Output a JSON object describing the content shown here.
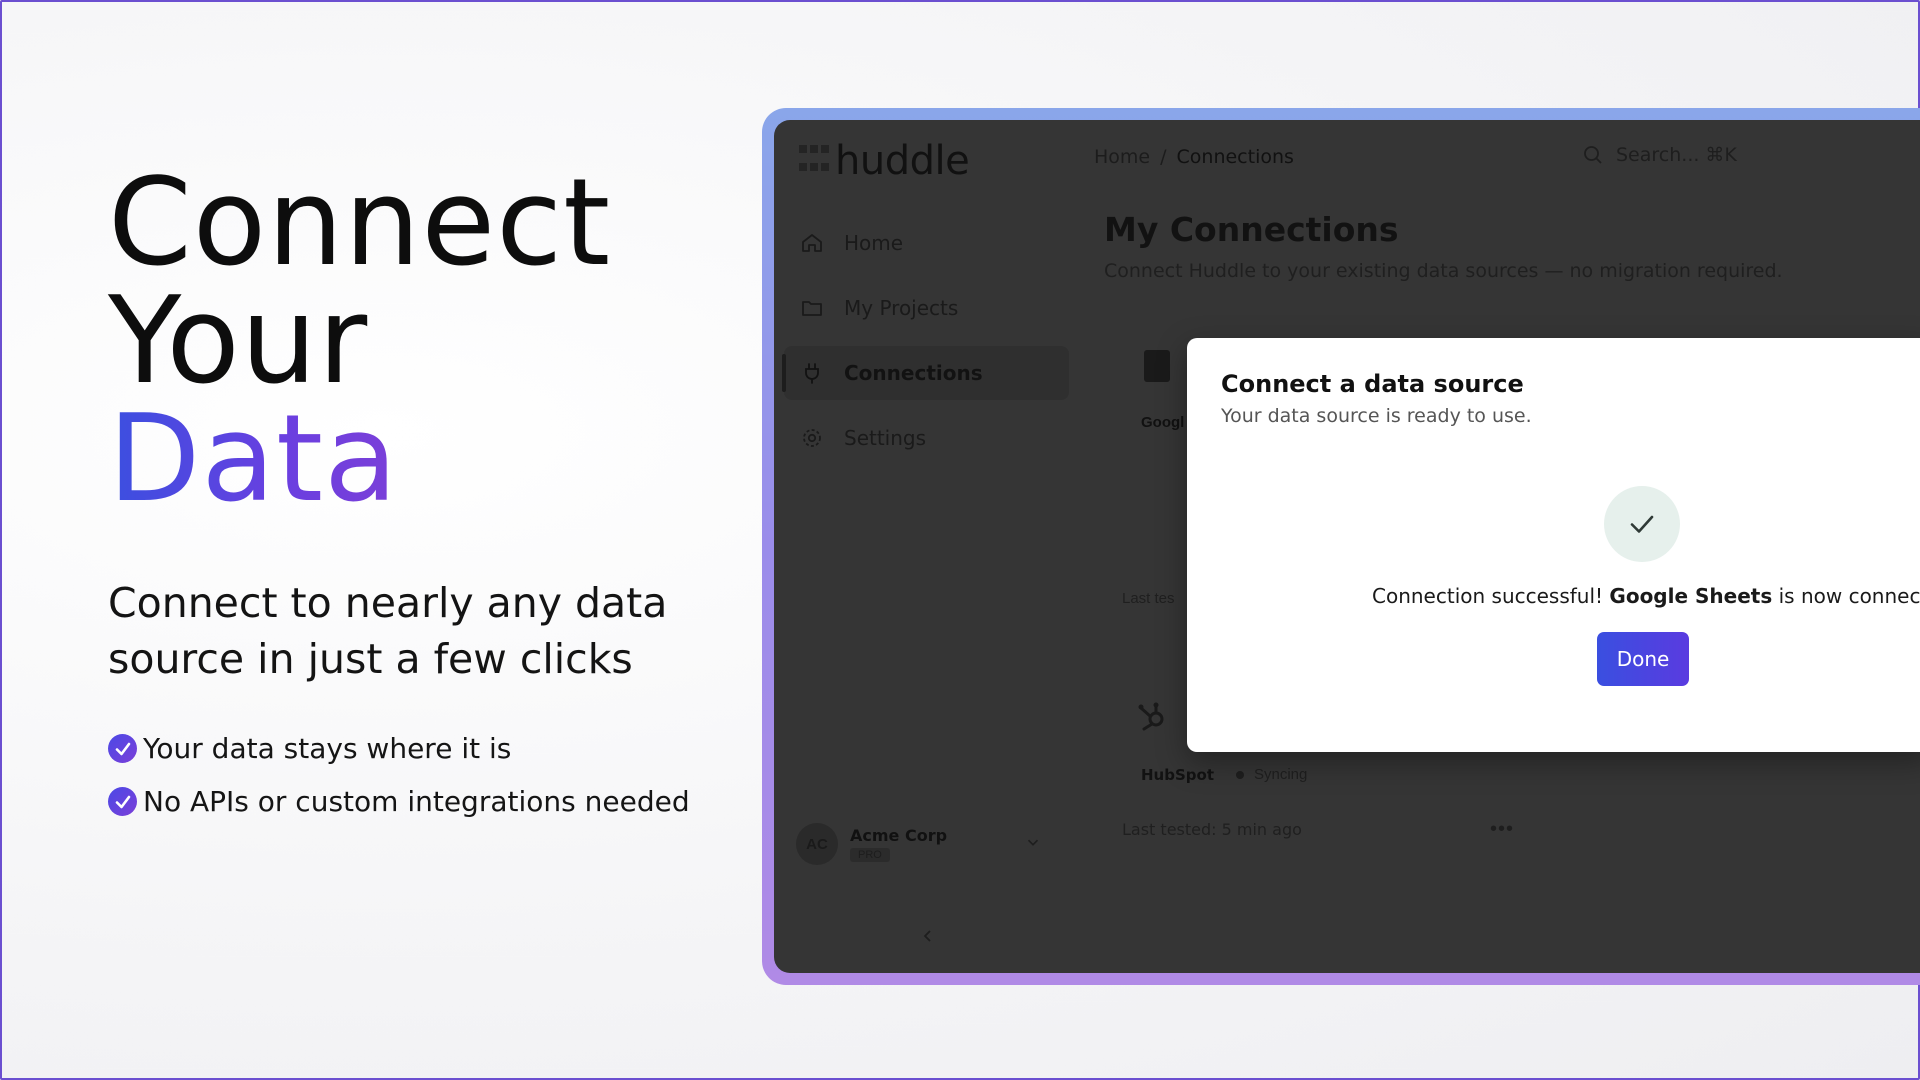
{
  "hero": {
    "line1": "Connect",
    "line2": "Your",
    "line3": "Data",
    "subtitle": "Connect to nearly any data source in just a few clicks",
    "bullets": [
      "Your data stays where it is",
      "No APIs or custom integrations needed"
    ]
  },
  "colors": {
    "accent_start": "#3b4fe0",
    "accent_end": "#7b3fd8",
    "app_dim": "#353535"
  },
  "app": {
    "logo": "huddle",
    "breadcrumb": {
      "home": "Home",
      "separator": "/",
      "current": "Connections"
    },
    "search": {
      "label": "Search... ⌘K",
      "icon": "search-icon"
    },
    "nav": [
      {
        "label": "Home",
        "icon": "home-icon"
      },
      {
        "label": "My Projects",
        "icon": "folder-icon"
      },
      {
        "label": "Connections",
        "icon": "plug-icon",
        "active": true
      },
      {
        "label": "Settings",
        "icon": "gear-icon"
      }
    ],
    "account": {
      "initials": "AC",
      "name": "Acme Corp",
      "plan": "PRO"
    },
    "page": {
      "title": "My Connections",
      "description": "Connect Huddle to your existing data sources — no migration required."
    },
    "cards": {
      "google_label": "Googl",
      "google_last": "Last tes",
      "hubspot_name": "HubSpot",
      "hubspot_status": "Syncing",
      "hubspot_last": "Last tested: 5 min ago",
      "more": "•••"
    }
  },
  "modal": {
    "title": "Connect a data source",
    "subtitle": "Your data source is ready to use.",
    "msg_prefix": "Connection successful! ",
    "msg_source": "Google Sheets",
    "msg_suffix": " is now connected.",
    "done": "Done"
  }
}
